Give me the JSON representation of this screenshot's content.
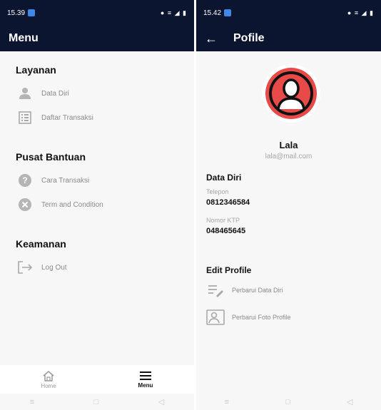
{
  "left": {
    "status": {
      "time": "15.39",
      "icons": "● ≡ ◢ ▮"
    },
    "appbar": {
      "title": "Menu"
    },
    "sections": {
      "layanan": {
        "title": "Layanan",
        "items": [
          "Data Diri",
          "Daftar Transaksi"
        ]
      },
      "bantuan": {
        "title": "Pusat Bantuan",
        "items": [
          "Cara Transaksi",
          "Term and Condition"
        ]
      },
      "keamanan": {
        "title": "Keamanan",
        "items": [
          "Log Out"
        ]
      }
    },
    "bottomnav": {
      "home": "Home",
      "menu": "Menu"
    }
  },
  "right": {
    "status": {
      "time": "15.42",
      "icons": "● ≡ ◢ ▮"
    },
    "appbar": {
      "title": "Pofile"
    },
    "profile": {
      "name": "Lala",
      "email": "lala@mail.com"
    },
    "data_diri": {
      "title": "Data Diri",
      "telepon_label": "Telepon",
      "telepon": "0812346584",
      "ktp_label": "Nomor KTP",
      "ktp": "048465645"
    },
    "edit": {
      "title": "Edit Profile",
      "items": [
        "Perbarui Data Diri",
        "Perbarui Foto Profile"
      ]
    }
  },
  "colors": {
    "appbar": "#0b1530",
    "avatar": "#e84a4a"
  }
}
